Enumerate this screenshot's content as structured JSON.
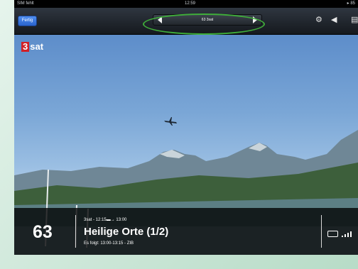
{
  "status_bar": {
    "carrier": "SIM fehlt",
    "time": "12:59",
    "right": "▸ 85"
  },
  "navbar": {
    "done_label": "Fertig",
    "channel_label": "63 3sat"
  },
  "video": {
    "logo_number": "3",
    "logo_text": "sat"
  },
  "program_info": {
    "channel_number": "63",
    "current_time": "3sat - 12:15▬→ 13:00",
    "current_title": "Heilige Orte (1/2)",
    "next": "Es folgt: 13:00-13:15 - ZIB"
  },
  "colors": {
    "accent": "#3fae3a",
    "done_button": "#2a63cc",
    "logo_red": "#d21f26"
  }
}
